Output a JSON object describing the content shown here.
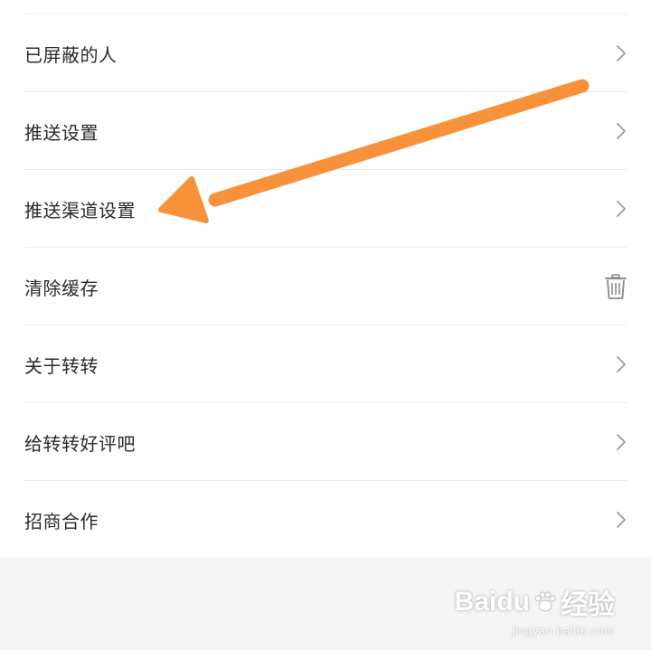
{
  "settings": {
    "items": [
      {
        "label": "已屏蔽的人",
        "icon": "chevron-right-icon"
      },
      {
        "label": "推送设置",
        "icon": "chevron-right-icon"
      },
      {
        "label": "推送渠道设置",
        "icon": "chevron-right-icon"
      },
      {
        "label": "清除缓存",
        "icon": "trash-icon"
      },
      {
        "label": "关于转转",
        "icon": "chevron-right-icon"
      },
      {
        "label": "给转转好评吧",
        "icon": "chevron-right-icon"
      },
      {
        "label": "招商合作",
        "icon": "chevron-right-icon"
      }
    ]
  },
  "annotation": {
    "arrow_color": "#f7923b",
    "target_item": "推送渠道设置"
  },
  "watermark": {
    "brand": "Baidu",
    "brand_suffix": "经验",
    "url": "jingyan.baidu.com"
  },
  "colors": {
    "text": "#2b2b2b",
    "divider": "#ececec",
    "icon": "#9a9a9a",
    "background": "#f5f5f5"
  }
}
